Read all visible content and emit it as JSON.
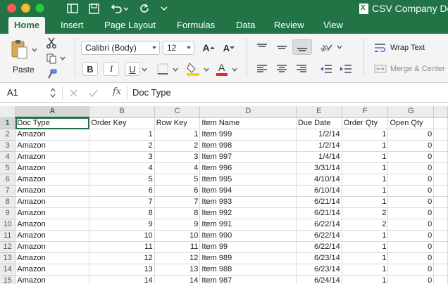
{
  "window": {
    "title": "CSV Company De"
  },
  "ribbon_tabs": [
    "Home",
    "Insert",
    "Page Layout",
    "Formulas",
    "Data",
    "Review",
    "View"
  ],
  "ribbon": {
    "paste_label": "Paste",
    "font_name": "Calibri (Body)",
    "font_size": "12",
    "bold": "B",
    "italic": "I",
    "underline": "U",
    "wrap_text": "Wrap Text",
    "merge_center": "Merge & Center"
  },
  "formula_bar": {
    "name_box": "A1",
    "fx": "fx",
    "value": "Doc Type"
  },
  "colors": {
    "accent": "#227447",
    "highlight": "#ffd500",
    "font_color": "#e52b2b"
  },
  "sheet": {
    "columns": [
      "A",
      "B",
      "C",
      "D",
      "E",
      "F",
      "G"
    ],
    "rows": [
      [
        "1",
        "Doc Type",
        "Order Key",
        "Row Key",
        "Item Name",
        "Due Date",
        "Order Qty",
        "Open Qty"
      ],
      [
        "2",
        "Amazon",
        "1",
        "1",
        "Item 999",
        "1/2/14",
        "1",
        "0"
      ],
      [
        "3",
        "Amazon",
        "2",
        "2",
        "Item 998",
        "1/2/14",
        "1",
        "0"
      ],
      [
        "4",
        "Amazon",
        "3",
        "3",
        "Item 997",
        "1/4/14",
        "1",
        "0"
      ],
      [
        "5",
        "Amazon",
        "4",
        "4",
        "Item 996",
        "3/31/14",
        "1",
        "0"
      ],
      [
        "6",
        "Amazon",
        "5",
        "5",
        "Item 995",
        "4/10/14",
        "1",
        "0"
      ],
      [
        "7",
        "Amazon",
        "6",
        "6",
        "Item 994",
        "6/10/14",
        "1",
        "0"
      ],
      [
        "8",
        "Amazon",
        "7",
        "7",
        "Item 993",
        "6/21/14",
        "1",
        "0"
      ],
      [
        "9",
        "Amazon",
        "8",
        "8",
        "Item 992",
        "6/21/14",
        "2",
        "0"
      ],
      [
        "10",
        "Amazon",
        "9",
        "9",
        "Item 991",
        "6/22/14",
        "2",
        "0"
      ],
      [
        "11",
        "Amazon",
        "10",
        "10",
        "Item 990",
        "6/22/14",
        "1",
        "0"
      ],
      [
        "12",
        "Amazon",
        "11",
        "11",
        "Item 99",
        "6/22/14",
        "1",
        "0"
      ],
      [
        "13",
        "Amazon",
        "12",
        "12",
        "Item 989",
        "6/23/14",
        "1",
        "0"
      ],
      [
        "14",
        "Amazon",
        "13",
        "13",
        "Item 988",
        "6/23/14",
        "1",
        "0"
      ],
      [
        "15",
        "Amazon",
        "14",
        "14",
        "Item 987",
        "6/24/14",
        "1",
        "0"
      ]
    ]
  }
}
